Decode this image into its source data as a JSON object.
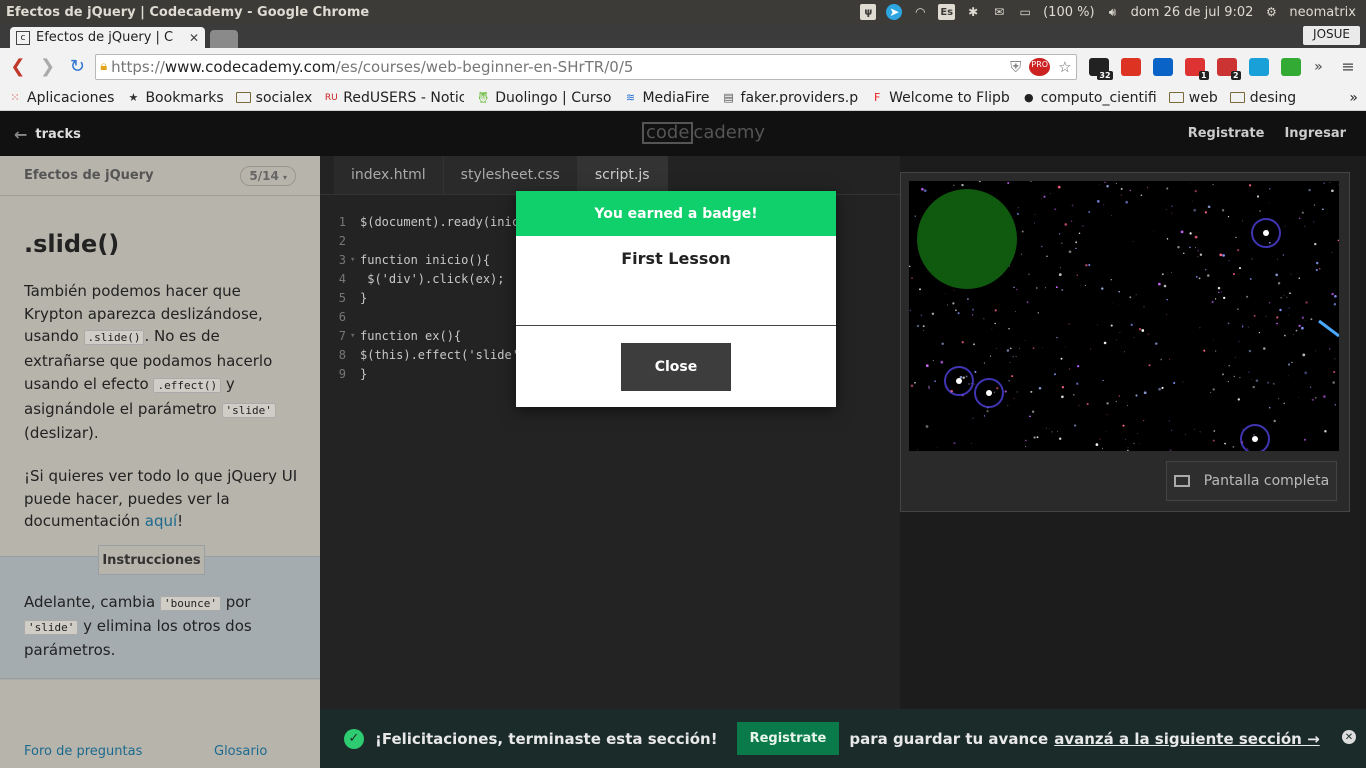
{
  "os": {
    "window_title": "Efectos de jQuery | Codecademy - Google Chrome",
    "keyboard_layout": "Es",
    "battery": "(100 %)",
    "datetime": "dom 26 de jul  9:02",
    "user": "neomatrix"
  },
  "browser": {
    "tab_title": "Efectos de jQuery | C",
    "profile_name": "JOSUE",
    "url_scheme": "https://",
    "url_host": "www.codecademy.com",
    "url_path": "/es/courses/web-beginner-en-SHrTR/0/5",
    "extensions": [
      {
        "name": "d-extension",
        "badge": "32",
        "color": "#222"
      },
      {
        "name": "flipboard",
        "badge": "",
        "color": "#d32"
      },
      {
        "name": "outlook",
        "badge": "",
        "color": "#0a64c8"
      },
      {
        "name": "gmail",
        "badge": "1",
        "color": "#d33"
      },
      {
        "name": "share-extension",
        "badge": "2",
        "color": "#c33"
      },
      {
        "name": "m-extension",
        "badge": "",
        "color": "#1aa0d8"
      },
      {
        "name": "bw-extension",
        "badge": "",
        "color": "#3a3"
      }
    ],
    "bookmarks": [
      {
        "label": "Aplicaciones",
        "icon": "apps-grid-icon"
      },
      {
        "label": "Bookmarks",
        "icon": "star-icon"
      },
      {
        "label": "socialex",
        "icon": "folder-icon"
      },
      {
        "label": "RedUSERS - Notic",
        "icon": "redusers-icon"
      },
      {
        "label": "Duolingo | Curso",
        "icon": "duolingo-icon"
      },
      {
        "label": "MediaFire",
        "icon": "mediafire-icon"
      },
      {
        "label": "faker.providers.p",
        "icon": "document-icon"
      },
      {
        "label": "Welcome to Flipb",
        "icon": "flipboard-icon"
      },
      {
        "label": "computo_cientifi",
        "icon": "github-icon"
      },
      {
        "label": "web",
        "icon": "folder-icon"
      },
      {
        "label": "desing",
        "icon": "folder-icon"
      }
    ],
    "bookmarks_overflow": "»"
  },
  "header": {
    "back_label": "tracks",
    "logo_box": "code",
    "logo_rest": "cademy",
    "register": "Registrate",
    "login": "Ingresar"
  },
  "lesson": {
    "course": "Efectos de jQuery",
    "progress": "5/14",
    "title": ".slide()",
    "p1_a": "También podemos hacer que Krypton aparezca deslizándose, usando ",
    "p1_code1": ".slide()",
    "p1_b": ". No es de extrañarse que podamos hacerlo usando el efecto ",
    "p1_code2": ".effect()",
    "p1_c": " y asignándole el parámetro ",
    "p1_code3": "'slide'",
    "p1_d": " (deslizar).",
    "p2_a": "¡Si quieres ver todo lo que jQuery UI puede hacer, puedes ver la documentación ",
    "p2_link": "aquí",
    "p2_b": "!",
    "instructions_label": "Instrucciones",
    "instr_a": "Adelante, cambia ",
    "instr_code1": "'bounce'",
    "instr_b": " por ",
    "instr_code2": "'slide'",
    "instr_c": " y elimina los otros dos parámetros.",
    "footer_forum": "Foro de preguntas",
    "footer_glossary": "Glosario"
  },
  "editor": {
    "tabs": [
      "index.html",
      "stylesheet.css",
      "script.js"
    ],
    "active_tab": 2,
    "lines": [
      {
        "num": "1",
        "fold": "",
        "text": "$(document).ready(inic"
      },
      {
        "num": "2",
        "fold": "",
        "text": ""
      },
      {
        "num": "3",
        "fold": "▾",
        "text": "function inicio(){"
      },
      {
        "num": "4",
        "fold": "",
        "text": " $('div').click(ex);"
      },
      {
        "num": "5",
        "fold": "",
        "text": "}"
      },
      {
        "num": "6",
        "fold": "",
        "text": ""
      },
      {
        "num": "7",
        "fold": "▾",
        "text": "function ex(){"
      },
      {
        "num": "8",
        "fold": "",
        "text": "$(this).effect('slide'"
      },
      {
        "num": "9",
        "fold": "",
        "text": "}"
      }
    ]
  },
  "preview": {
    "fullscreen_label": "Pantalla completa"
  },
  "modal": {
    "header": "You earned a badge!",
    "badge_name": "First Lesson",
    "close_label": "Close"
  },
  "banner": {
    "title": "¡Felicitaciones, terminaste esta sección!",
    "register": "Registrate",
    "message": "para guardar tu avance",
    "link": "avanzá a la siguiente sección →"
  },
  "colors": {
    "accent_green": "#0fd06a",
    "register_green": "#0b7a4a",
    "link_blue": "#1b6a8f",
    "os_bar": "#3c3b37"
  }
}
